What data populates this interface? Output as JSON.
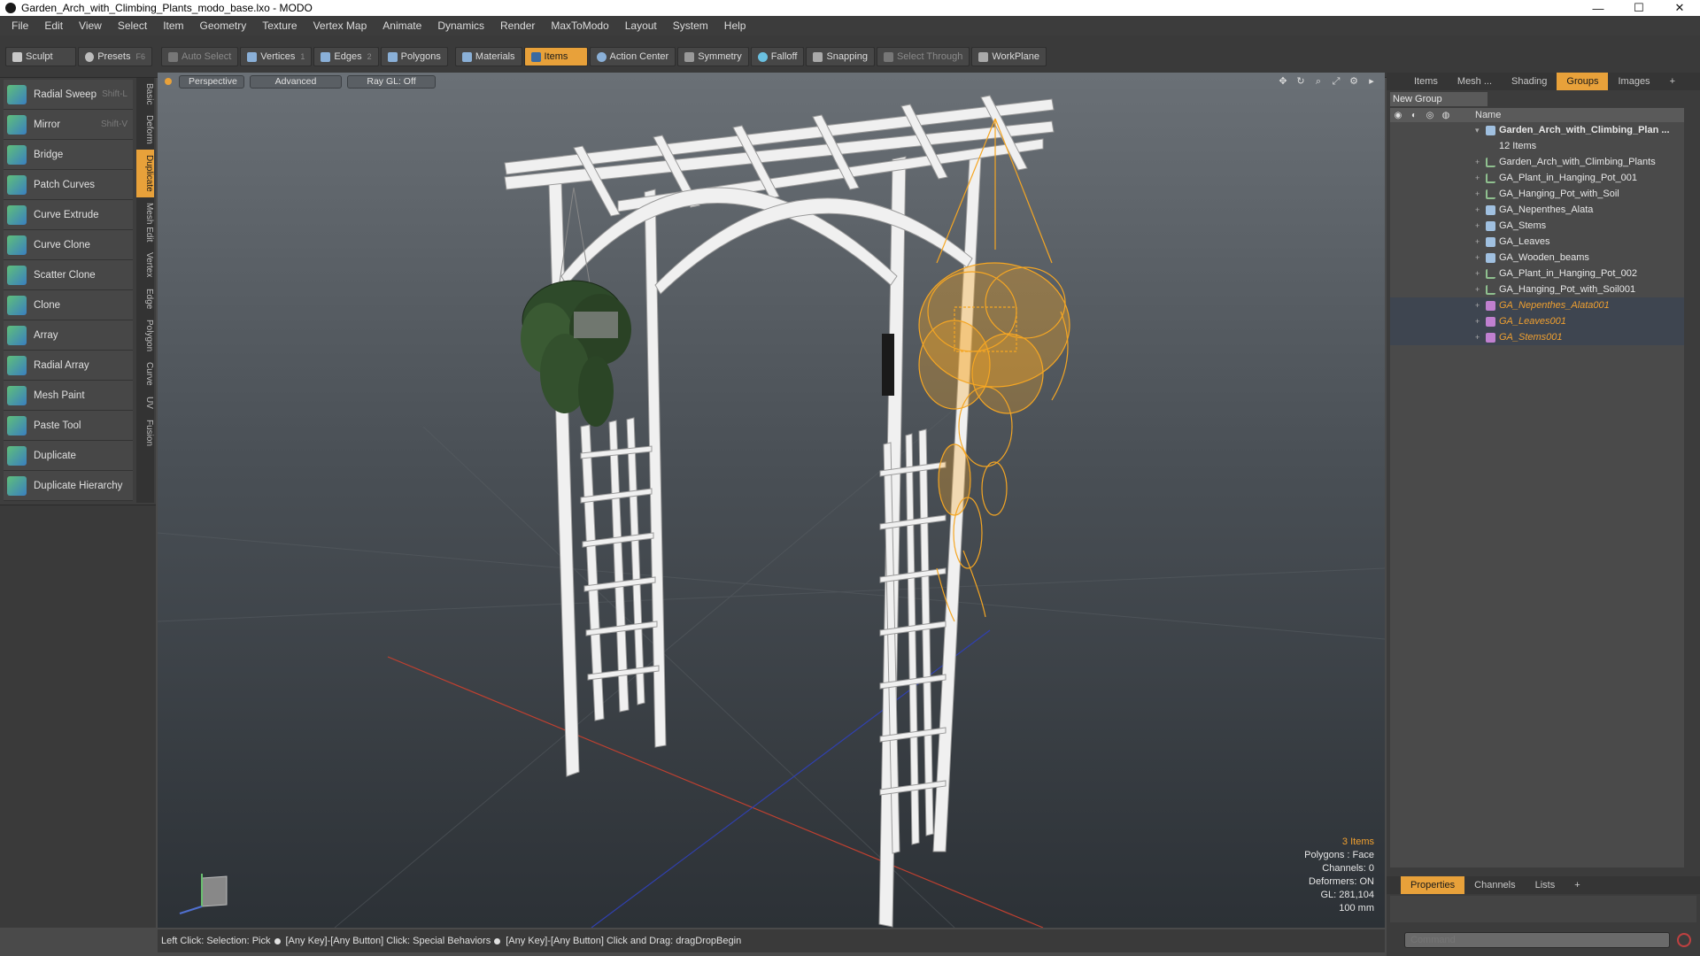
{
  "window": {
    "title": "Garden_Arch_with_Climbing_Plants_modo_base.lxo - MODO",
    "controls": [
      "—",
      "☐",
      "✕"
    ]
  },
  "menu": [
    "File",
    "Edit",
    "View",
    "Select",
    "Item",
    "Geometry",
    "Texture",
    "Vertex Map",
    "Animate",
    "Dynamics",
    "Render",
    "MaxToModo",
    "Layout",
    "System",
    "Help"
  ],
  "toolbar": {
    "sculpt": "Sculpt",
    "presets": "Presets",
    "presets_key": "F6",
    "auto_select": "Auto Select",
    "vertices": "Vertices",
    "vertices_count": "1",
    "edges": "Edges",
    "edges_count": "2",
    "polygons": "Polygons",
    "materials": "Materials",
    "items": "Items",
    "action_center": "Action Center",
    "symmetry": "Symmetry",
    "falloff": "Falloff",
    "snapping": "Snapping",
    "select_through": "Select Through",
    "workplane": "WorkPlane"
  },
  "tools": [
    {
      "label": "Radial Sweep",
      "key": "Shift-L"
    },
    {
      "label": "Mirror",
      "key": "Shift-V"
    },
    {
      "label": "Bridge",
      "key": ""
    },
    {
      "label": "Patch Curves",
      "key": ""
    },
    {
      "label": "Curve Extrude",
      "key": ""
    },
    {
      "label": "Curve Clone",
      "key": ""
    },
    {
      "label": "Scatter Clone",
      "key": ""
    },
    {
      "label": "Clone",
      "key": ""
    },
    {
      "label": "Array",
      "key": ""
    },
    {
      "label": "Radial Array",
      "key": ""
    },
    {
      "label": "Mesh Paint",
      "key": ""
    },
    {
      "label": "Paste Tool",
      "key": ""
    },
    {
      "label": "Duplicate",
      "key": ""
    },
    {
      "label": "Duplicate Hierarchy",
      "key": ""
    }
  ],
  "vtabs": [
    "Basic",
    "Deform",
    "Duplicate",
    "Mesh Edit",
    "Vertex",
    "Edge",
    "Polygon",
    "Curve",
    "UV",
    "Fusion"
  ],
  "viewport": {
    "view": "Perspective",
    "style": "Advanced",
    "raygl": "Ray GL: Off",
    "info": {
      "items": "3 Items",
      "polygons": "Polygons : Face",
      "channels": "Channels: 0",
      "deformers": "Deformers: ON",
      "gl": "GL: 281,104",
      "scale": "100 mm"
    }
  },
  "status": {
    "part1": "Left Click: Selection: Pick",
    "part2": "[Any Key]-[Any Button] Click: Special Behaviors",
    "part3": "[Any Key]-[Any Button] Click and Drag: dragDropBegin"
  },
  "rightpanel": {
    "tabs": [
      "Items",
      "Mesh ...",
      "Shading",
      "Groups",
      "Images"
    ],
    "new_group": "New Group",
    "name_header": "Name",
    "root": {
      "name": "Garden_Arch_with_Climbing_Plan ...",
      "count": "12 Items"
    },
    "items": [
      {
        "name": "Garden_Arch_with_Climbing_Plants",
        "icon": "locator",
        "selected": false
      },
      {
        "name": "GA_Plant_in_Hanging_Pot_001",
        "icon": "locator",
        "selected": false
      },
      {
        "name": "GA_Hanging_Pot_with_Soil",
        "icon": "locator",
        "selected": false
      },
      {
        "name": "GA_Nepenthes_Alata",
        "icon": "mesh",
        "selected": false
      },
      {
        "name": "GA_Stems",
        "icon": "mesh",
        "selected": false
      },
      {
        "name": "GA_Leaves",
        "icon": "mesh",
        "selected": false
      },
      {
        "name": "GA_Wooden_beams",
        "icon": "mesh",
        "selected": false
      },
      {
        "name": "GA_Plant_in_Hanging_Pot_002",
        "icon": "locator",
        "selected": false
      },
      {
        "name": "GA_Hanging_Pot_with_Soil001",
        "icon": "locator",
        "selected": false
      },
      {
        "name": "GA_Nepenthes_Alata001",
        "icon": "group",
        "selected": true
      },
      {
        "name": "GA_Leaves001",
        "icon": "group",
        "selected": true
      },
      {
        "name": "GA_Stems001",
        "icon": "group",
        "selected": true
      }
    ],
    "bottom_tabs": [
      "Properties",
      "Channels",
      "Lists"
    ],
    "command_placeholder": "Command"
  },
  "colors": {
    "accent": "#e8a13a",
    "selection_wire": "#f5a623"
  }
}
